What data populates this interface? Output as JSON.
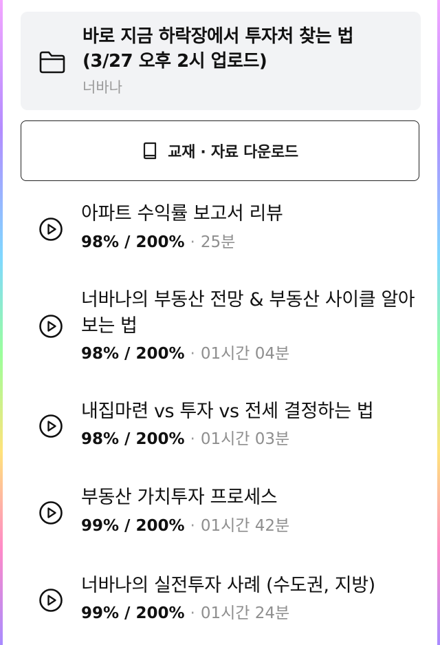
{
  "folder": {
    "icon": "folder-icon",
    "title": "바로 지금 하락장에서 투자처 찾는 법 (3/27 오후 2시 업로드)",
    "author": "너바나"
  },
  "download": {
    "icon": "book-icon",
    "label": "교재 · 자료 다운로드"
  },
  "lessons": [
    {
      "icon": "play-circle-icon",
      "title": "아파트 수익률 보고서 리뷰",
      "progress": "98% / 200%",
      "separator": "·",
      "duration": "25분"
    },
    {
      "icon": "play-circle-icon",
      "title": "너바나의 부동산 전망 & 부동산 사이클 알아보는 법",
      "progress": "98% / 200%",
      "separator": "·",
      "duration": "01시간 04분"
    },
    {
      "icon": "play-circle-icon",
      "title": "내집마련 vs 투자 vs 전세 결정하는 법",
      "progress": "98% / 200%",
      "separator": "·",
      "duration": "01시간 03분"
    },
    {
      "icon": "play-circle-icon",
      "title": "부동산 가치투자 프로세스",
      "progress": "99% / 200%",
      "separator": "·",
      "duration": "01시간 42분"
    },
    {
      "icon": "play-circle-icon",
      "title": "너바나의 실전투자 사례 (수도권, 지방)",
      "progress": "99% / 200%",
      "separator": "·",
      "duration": "01시간 24분"
    }
  ]
}
